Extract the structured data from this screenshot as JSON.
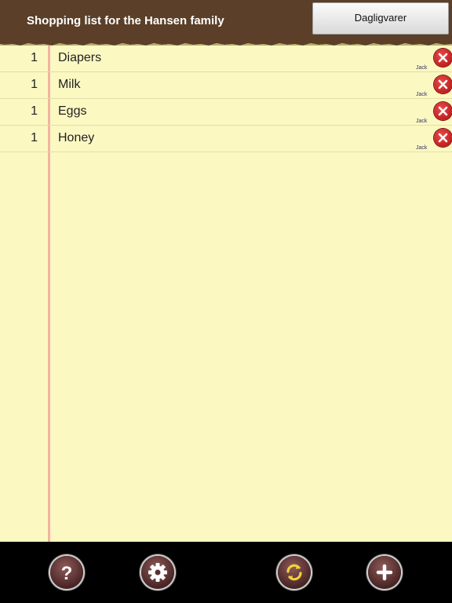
{
  "header": {
    "title": "Shopping list for the Hansen family",
    "list_picker_label": "Dagligvarer"
  },
  "items": [
    {
      "qty": "1",
      "name": "Diapers",
      "added_by": "Jack"
    },
    {
      "qty": "1",
      "name": "Milk",
      "added_by": "Jack"
    },
    {
      "qty": "1",
      "name": "Eggs",
      "added_by": "Jack"
    },
    {
      "qty": "1",
      "name": "Honey",
      "added_by": "Jack"
    }
  ],
  "toolbar": {
    "buttons": [
      {
        "icon": "help-icon"
      },
      {
        "icon": "settings-gear-icon"
      },
      {
        "icon": "sync-icon"
      },
      {
        "icon": "add-icon"
      }
    ]
  },
  "colors": {
    "header_bg": "#5b3f28",
    "paper_bg": "#fcf8c2",
    "margin_line": "#f1b4a0",
    "delete_red": "#c41a1a",
    "toolbar_bg": "#000000"
  }
}
